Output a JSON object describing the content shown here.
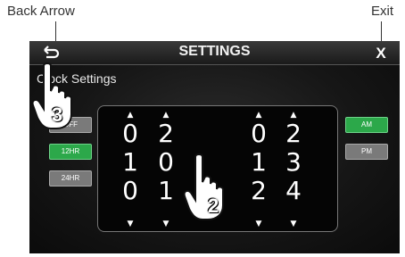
{
  "callouts": {
    "back": "Back Arrow",
    "exit": "Exit"
  },
  "header": {
    "title": "SETTINGS",
    "back_icon": "back-arrow-icon",
    "exit_label": "X"
  },
  "section": {
    "label": "Clock Settings"
  },
  "format_buttons": [
    {
      "label": "OFF",
      "state": "inactive"
    },
    {
      "label": "12HR",
      "state": "active"
    },
    {
      "label": "24HR",
      "state": "inactive"
    }
  ],
  "ampm_buttons": [
    {
      "label": "AM",
      "state": "active"
    },
    {
      "label": "PM",
      "state": "inactive"
    }
  ],
  "time_columns": [
    {
      "digits": [
        "0",
        "1",
        "0"
      ]
    },
    {
      "digits": [
        "2",
        "0",
        "1"
      ]
    },
    {
      "digits": [
        "0",
        "1",
        "2"
      ]
    },
    {
      "digits": [
        "2",
        "3",
        "4"
      ]
    }
  ],
  "arrows": {
    "up": "▲",
    "down": "▼"
  },
  "annotations": {
    "step_back": "3",
    "step_scroll": "2"
  },
  "colors": {
    "active": "#2ca84a",
    "inactive": "#7a7a7a"
  }
}
